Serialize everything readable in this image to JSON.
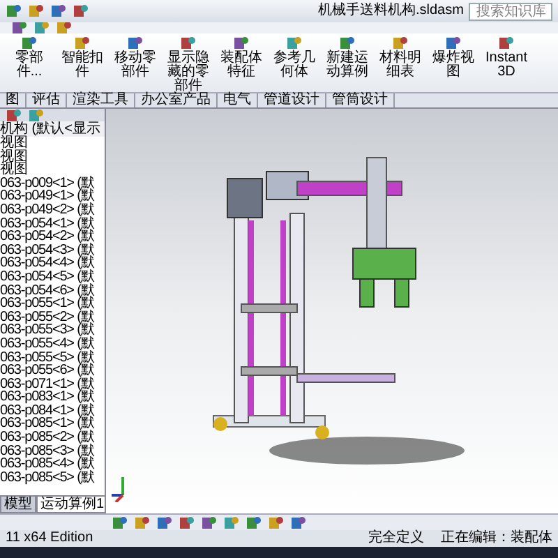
{
  "window": {
    "title": "机械手送料机构.sldasm",
    "search": {
      "placeholder": "搜索知识库"
    }
  },
  "ribbon": {
    "buttons": [
      {
        "label": "零部件..."
      },
      {
        "label": "智能扣件"
      },
      {
        "label": "移动零部件"
      },
      {
        "label": "显示隐藏的零部件"
      },
      {
        "label": "装配体特征"
      },
      {
        "label": "参考几何体"
      },
      {
        "label": "新建运动算例"
      },
      {
        "label": "材料明细表"
      },
      {
        "label": "爆炸视图"
      },
      {
        "label": "Instant3D"
      }
    ]
  },
  "tabs": [
    {
      "label": "图",
      "selected": false
    },
    {
      "label": "评估",
      "selected": false
    },
    {
      "label": "渲染工具",
      "selected": false
    },
    {
      "label": "办公室产品",
      "selected": false
    },
    {
      "label": "电气",
      "selected": false
    },
    {
      "label": "管道设计",
      "selected": false
    },
    {
      "label": "管筒设计",
      "selected": false
    }
  ],
  "tree": {
    "header": "机构 (默认<显示",
    "views": [
      "视图",
      "视图",
      "视图"
    ],
    "parts": [
      "063-p009<1> (默",
      "063-p049<1> (默",
      "063-p049<2> (默",
      "063-p054<1> (默",
      "063-p054<2> (默",
      "063-p054<3> (默",
      "063-p054<4> (默",
      "063-p054<5> (默",
      "063-p054<6> (默",
      "063-p055<1> (默",
      "063-p055<2> (默",
      "063-p055<3> (默",
      "063-p055<4> (默",
      "063-p055<5> (默",
      "063-p055<6> (默",
      "063-p071<1> (默",
      "063-p083<1> (默",
      "063-p084<1> (默",
      "063-p085<1> (默",
      "063-p085<2> (默",
      "063-p085<3> (默",
      "063-p085<4> (默",
      "063-p085<5> (默"
    ]
  },
  "bottom_tabs": [
    {
      "label": "模型",
      "selected": false
    },
    {
      "label": "运动算例1",
      "selected": true
    }
  ],
  "status_bar": {
    "edition": "11 x64 Edition",
    "state": "完全定义",
    "mode": "正在编辑：装配体"
  }
}
